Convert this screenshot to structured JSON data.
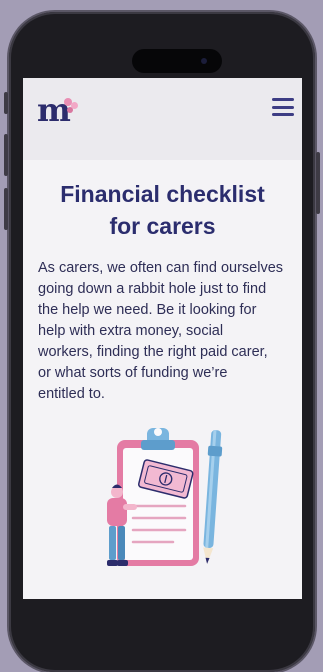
{
  "header": {
    "logo_text": "m",
    "menu_icon": "hamburger-menu-icon"
  },
  "main": {
    "title_line1": "Financial checklist",
    "title_line2": "for carers",
    "intro_lines": [
      "As carers, we often can find ourselves",
      "going down a rabbit hole just to find",
      "the help we need. Be it looking for",
      "help with extra money, social",
      "workers, finding the right paid carer,",
      "or what sorts of funding we’re",
      "entitled to."
    ]
  },
  "illustration": {
    "icon": "clipboard-money-pen-illustration"
  },
  "colors": {
    "brand_navy": "#2b2d6e",
    "brand_pink": "#e98fb4",
    "clipboard_blue": "#7ab5df"
  }
}
